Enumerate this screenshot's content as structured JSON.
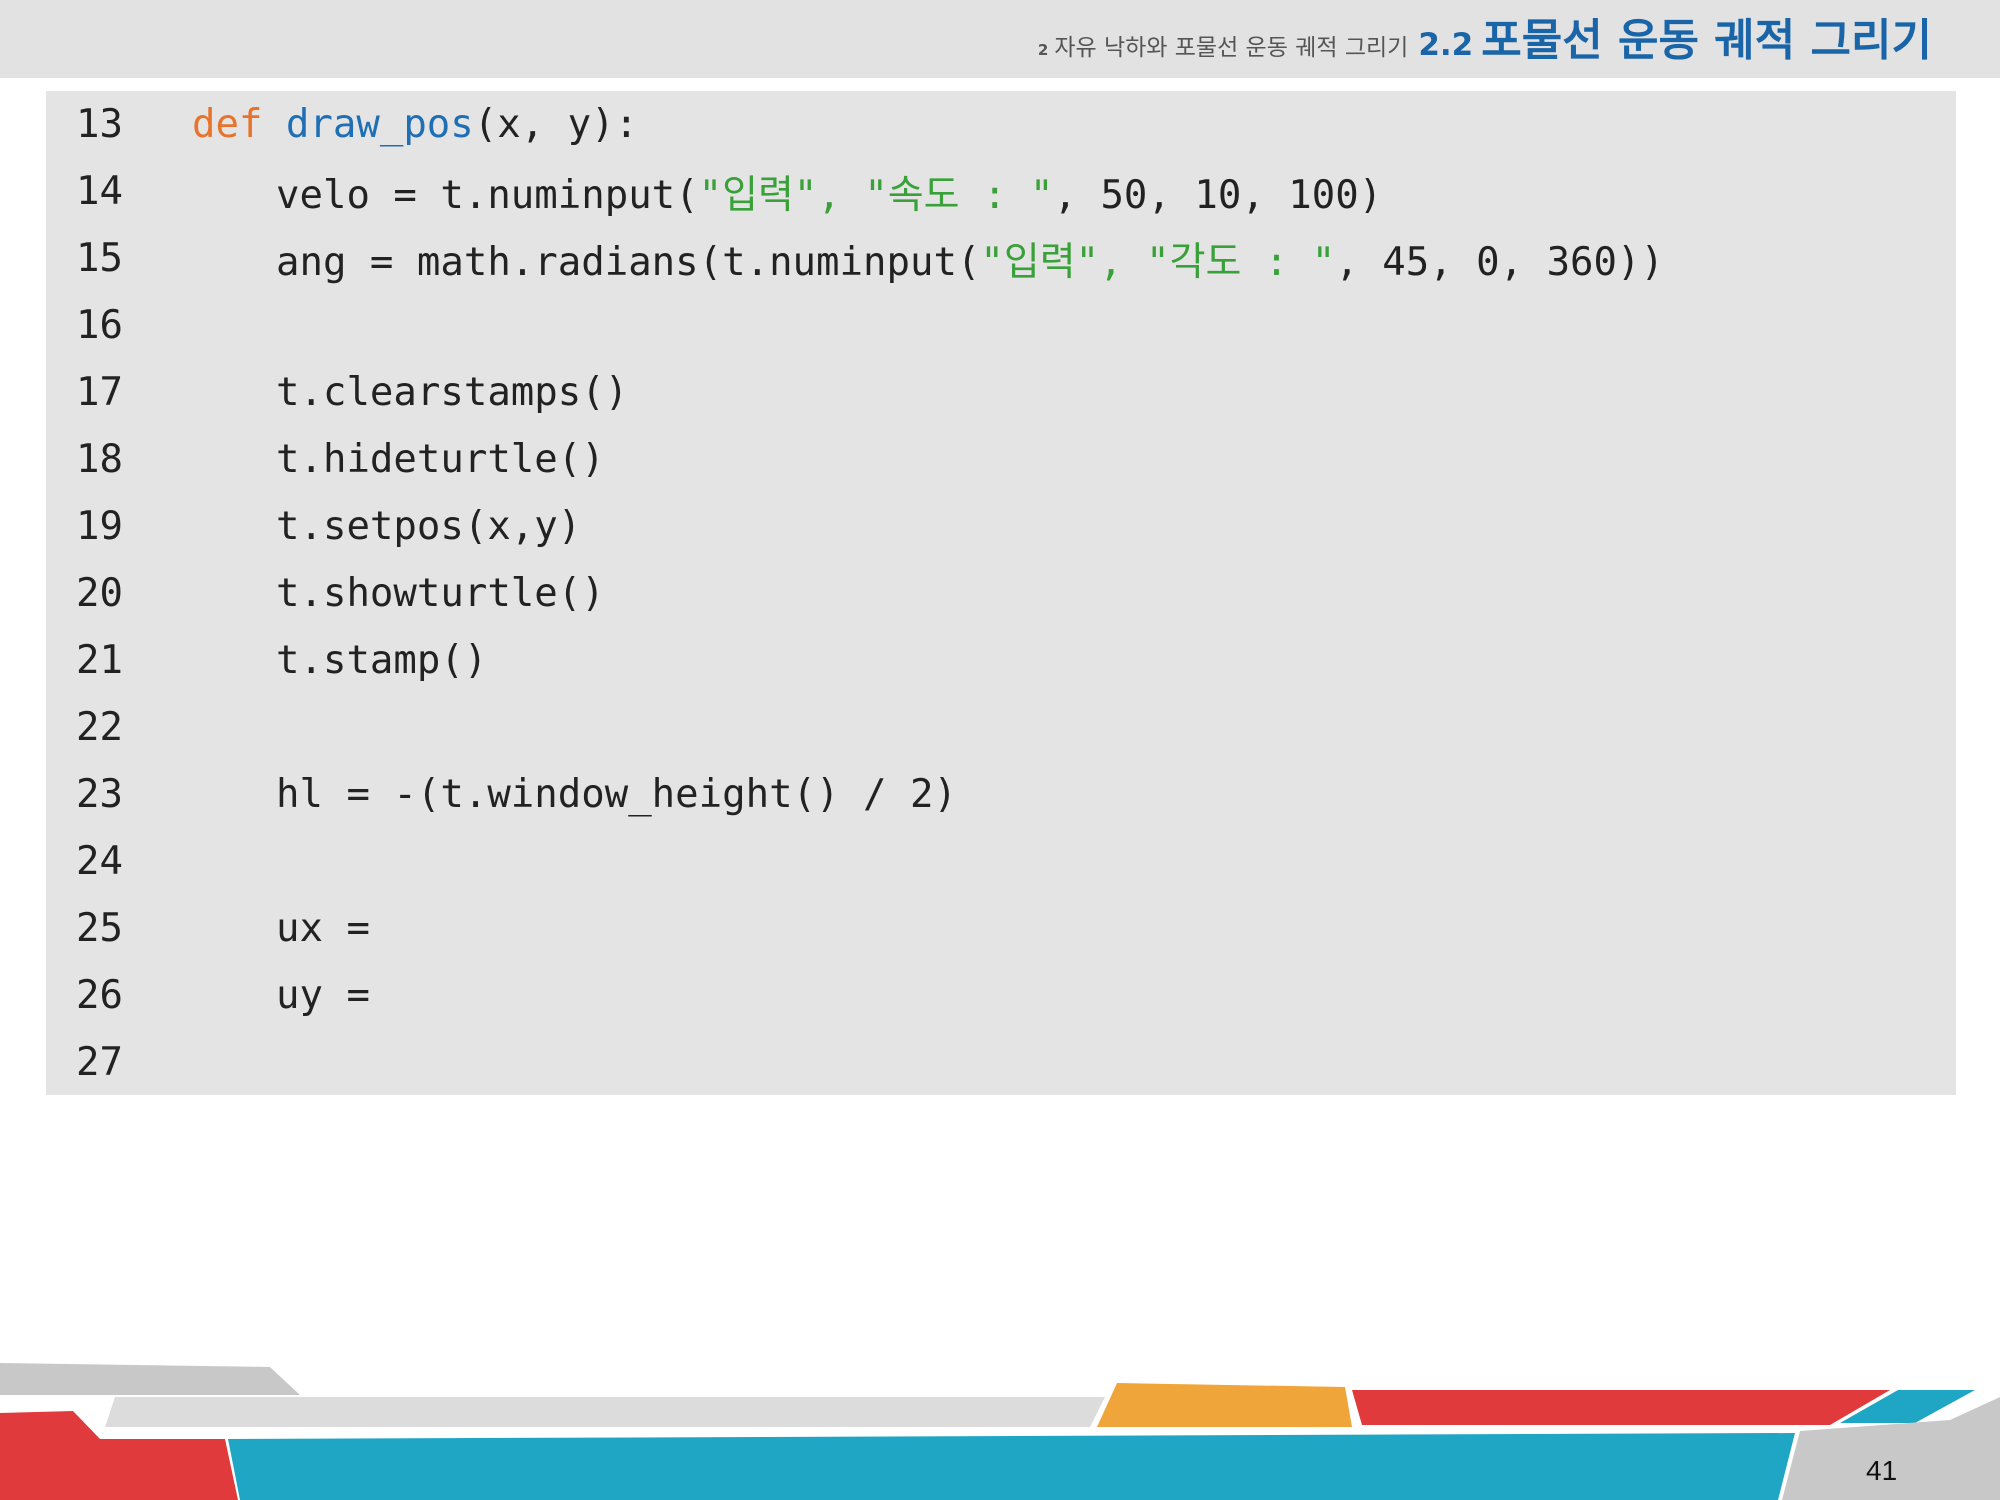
{
  "header": {
    "chapter_number": "2",
    "chapter_title": "자유 낙하와 포물선 운동 궤적 그리기",
    "section_number": "2.2",
    "section_title": "포물선 운동 궤적 그리기"
  },
  "code": {
    "lines": [
      {
        "num": "13",
        "indent": 0,
        "tokens": [
          [
            "kw",
            "def "
          ],
          [
            "fn",
            "draw_pos"
          ],
          [
            "plain",
            "(x, y):"
          ]
        ]
      },
      {
        "num": "14",
        "indent": 1,
        "tokens": [
          [
            "plain",
            "velo = t.numinput("
          ],
          [
            "str",
            "\"입력\", \"속도 : \""
          ],
          [
            "plain",
            ", 50, 10, 100)"
          ]
        ]
      },
      {
        "num": "15",
        "indent": 1,
        "tokens": [
          [
            "plain",
            "ang = math.radians(t.numinput("
          ],
          [
            "str",
            "\"입력\", \"각도 : \""
          ],
          [
            "plain",
            ", 45, 0, 360))"
          ]
        ]
      },
      {
        "num": "16",
        "indent": 1,
        "tokens": []
      },
      {
        "num": "17",
        "indent": 1,
        "tokens": [
          [
            "plain",
            "t.clearstamps()"
          ]
        ]
      },
      {
        "num": "18",
        "indent": 1,
        "tokens": [
          [
            "plain",
            "t.hideturtle()"
          ]
        ]
      },
      {
        "num": "19",
        "indent": 1,
        "tokens": [
          [
            "plain",
            "t.setpos(x,y)"
          ]
        ]
      },
      {
        "num": "20",
        "indent": 1,
        "tokens": [
          [
            "plain",
            "t.showturtle()"
          ]
        ]
      },
      {
        "num": "21",
        "indent": 1,
        "tokens": [
          [
            "plain",
            "t.stamp()"
          ]
        ]
      },
      {
        "num": "22",
        "indent": 1,
        "tokens": []
      },
      {
        "num": "23",
        "indent": 1,
        "tokens": [
          [
            "plain",
            "hl = -(t.window_height() / 2)"
          ]
        ]
      },
      {
        "num": "24",
        "indent": 1,
        "tokens": []
      },
      {
        "num": "25",
        "indent": 1,
        "tokens": [
          [
            "plain",
            "ux ="
          ]
        ]
      },
      {
        "num": "26",
        "indent": 1,
        "tokens": [
          [
            "plain",
            "uy ="
          ]
        ]
      },
      {
        "num": "27",
        "indent": 1,
        "tokens": []
      }
    ]
  },
  "footer": {
    "page_number": "41",
    "colors": {
      "red": "#e03a3c",
      "teal": "#1fa6c5",
      "orange": "#f0a53a",
      "light_gray": "#dcdcdc",
      "mid_gray": "#c8c8c8"
    }
  }
}
